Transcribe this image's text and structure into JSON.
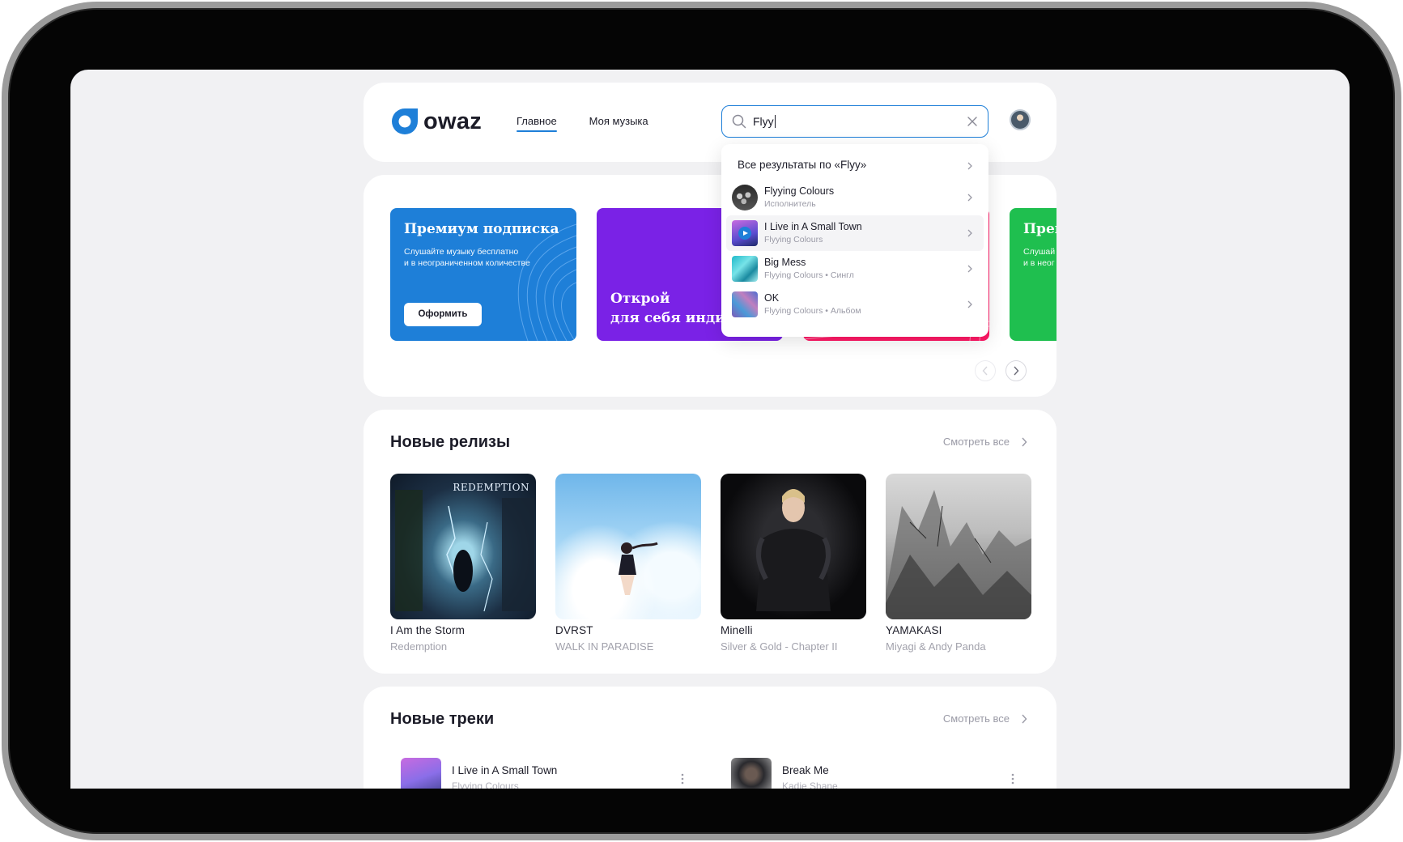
{
  "brand": {
    "name": "owaz",
    "color": "#1e7fd8"
  },
  "nav": {
    "items": [
      {
        "label": "Главное",
        "active": true
      },
      {
        "label": "Моя музыка",
        "active": false
      }
    ]
  },
  "search": {
    "value": "Flyy",
    "icon": "search-icon"
  },
  "dropdown": {
    "all_results": "Все результаты по «Flyy»",
    "items": [
      {
        "title": "Flyying Colours",
        "subtitle": "Исполнитель"
      },
      {
        "title": "I Live in A Small Town",
        "subtitle": "Flyying Colours"
      },
      {
        "title": "Big Mess",
        "subtitle": "Flyying Colours • Сингл"
      },
      {
        "title": "OK",
        "subtitle": "Flyying Colours • Альбом"
      }
    ]
  },
  "banners": {
    "premium": {
      "title": "Премиум подписка",
      "line1": "Слушайте музыку бесплатно",
      "line2": "и в неограниченном количестве",
      "button": "Оформить"
    },
    "indie": {
      "line1": "Открой",
      "line2": "для себя инди"
    },
    "premium2": {
      "title": "Прем",
      "line1": "Слушай",
      "line2": "и в неог"
    },
    "colors": [
      "#1e7fd8",
      "#7a22e6",
      "#ff1a66",
      "#1fbf4f"
    ]
  },
  "releases": {
    "title": "Новые релизы",
    "see_all": "Смотреть все",
    "items": [
      {
        "title": "I Am the Storm",
        "subtitle": "Redemption",
        "cover_text": "REDEMPTION"
      },
      {
        "title": "DVRST",
        "subtitle": "WALK IN PARADISE"
      },
      {
        "title": "Minelli",
        "subtitle": "Silver & Gold - Chapter II"
      },
      {
        "title": "YAMAKASI",
        "subtitle": "Miyagi & Andy Panda"
      }
    ]
  },
  "tracks": {
    "title": "Новые треки",
    "see_all": "Смотреть все",
    "items": [
      {
        "title": "I Live in A Small Town",
        "subtitle": "Flyying Colours"
      },
      {
        "title": "Break Me",
        "subtitle": "Kadie Shane"
      }
    ]
  }
}
